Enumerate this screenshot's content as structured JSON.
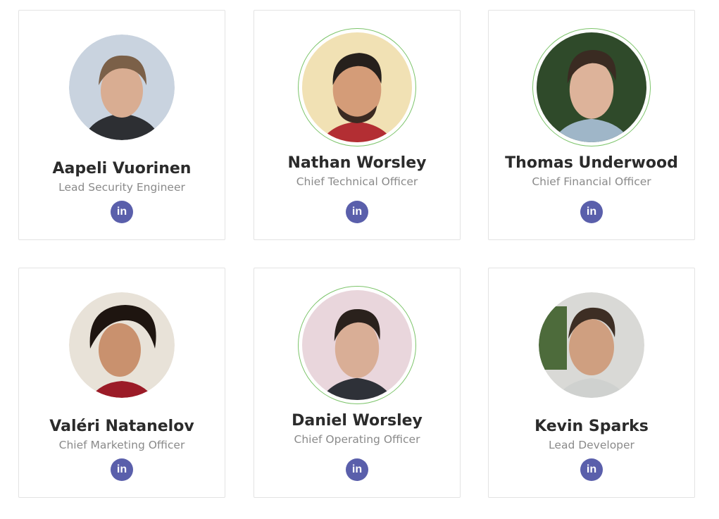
{
  "team": {
    "members": [
      {
        "name": "Aapeli Vuorinen",
        "role": "Lead Security Engineer",
        "linkedin_label": "in"
      },
      {
        "name": "Nathan Worsley",
        "role": "Chief Technical Officer",
        "linkedin_label": "in"
      },
      {
        "name": "Thomas Underwood",
        "role": "Chief Financial Officer",
        "linkedin_label": "in"
      },
      {
        "name": "Valéri Natanelov",
        "role": "Chief Marketing Officer",
        "linkedin_label": "in"
      },
      {
        "name": "Daniel Worsley",
        "role": "Chief Operating Officer",
        "linkedin_label": "in"
      },
      {
        "name": "Kevin Sparks",
        "role": "Lead Developer",
        "linkedin_label": "in"
      }
    ]
  },
  "colors": {
    "linkedin_badge": "#5a5fab",
    "avatar_ring": "#7cc46a",
    "name_text": "#2b2b2b",
    "role_text": "#8a8a8a"
  },
  "icons": {
    "linkedin": "linkedin-icon"
  }
}
